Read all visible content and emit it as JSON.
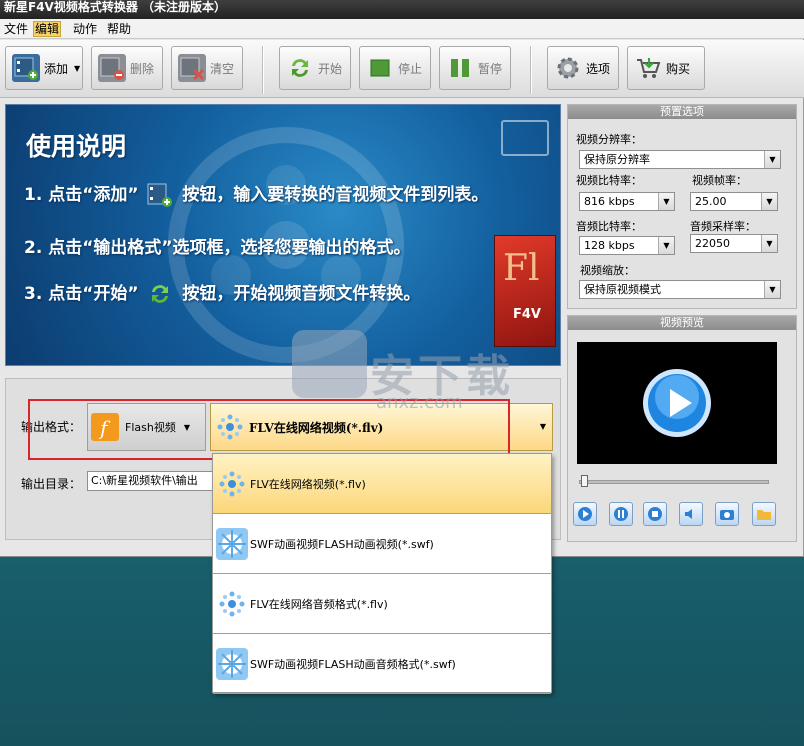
{
  "window": {
    "title": "新星F4V视频格式转换器 （未注册版本）"
  },
  "menu": {
    "items": [
      "文件",
      "编辑",
      "动作",
      "帮助"
    ],
    "active_index": 1
  },
  "toolbar": {
    "add": "添加",
    "delete": "删除",
    "clear": "清空",
    "start": "开始",
    "stop": "停止",
    "pause": "暂停",
    "options": "选项",
    "buy": "购买"
  },
  "banner": {
    "title": "使用说明",
    "line1_a": "1. 点击“添加”",
    "line1_b": "按钮，输入要转换的音视频文件到列表。",
    "line2": "2. 点击“输出格式”选项框，选择您要输出的格式。",
    "line3_a": "3. 点击“开始”",
    "line3_b": "按钮，开始视频音频文件转换。",
    "box_big": "Fl",
    "box_small": "F4V"
  },
  "preset": {
    "header": "预置选项",
    "resolution_label": "视频分辨率：",
    "resolution_value": "保持原分辨率",
    "vbitrate_label": "视频比特率：",
    "vbitrate_value": "816 kbps",
    "fps_label": "视频帧率：",
    "fps_value": "25.00",
    "abitrate_label": "音频比特率：",
    "abitrate_value": "128 kbps",
    "samplerate_label": "音频采样率：",
    "samplerate_value": "22050",
    "scale_label": "视频缩放：",
    "scale_value": "保持原视频模式"
  },
  "preview": {
    "header": "视频预览"
  },
  "output": {
    "format_label": "输出格式：",
    "category": "Flash视频",
    "format_value": "FLV在线网络视频(*.flv)",
    "dir_label": "输出目录：",
    "dir_value": "C:\\新星视频软件\\输出"
  },
  "dropdown": {
    "options": [
      "FLV在线网络视频(*.flv)",
      "SWF动画视频FLASH动画视频(*.swf)",
      "FLV在线网络音频格式(*.flv)",
      "SWF动画视频FLASH动画音频格式(*.swf)"
    ],
    "selected_index": 0
  },
  "watermark": {
    "text": "安下载",
    "sub": "anxz.com"
  },
  "colors": {
    "highlight_box": "#d9262b",
    "menu_active": "#f6d46a",
    "selected_option": "#fcd77a"
  }
}
